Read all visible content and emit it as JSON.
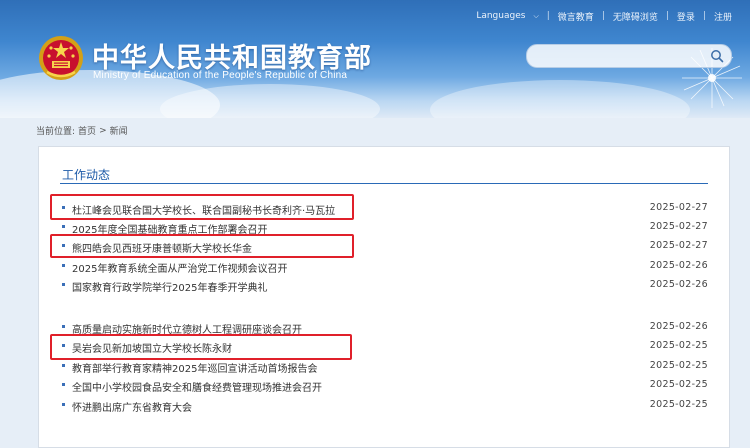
{
  "topnav": {
    "languages": "Languages",
    "wechat": "微言教育",
    "accessibility": "无障碍浏览",
    "login": "登录",
    "register": "注册"
  },
  "header": {
    "title_cn": "中华人民共和国教育部",
    "title_en": "Ministry of Education of the People's Republic of China"
  },
  "search": {
    "placeholder": ""
  },
  "breadcrumb": {
    "label": "当前位置:",
    "home": "首页",
    "sep": ">",
    "current": "新闻"
  },
  "section": {
    "title": "工作动态",
    "items": [
      {
        "text": "杜江峰会见联合国大学校长、联合国副秘书长奇利齐·马瓦拉",
        "date": "2025-02-27",
        "highlighted": true
      },
      {
        "text": "2025年度全国基础教育重点工作部署会召开",
        "date": "2025-02-27",
        "highlighted": false
      },
      {
        "text": "熊四皓会见西班牙康普顿斯大学校长华金",
        "date": "2025-02-27",
        "highlighted": true
      },
      {
        "text": "2025年教育系统全面从严治党工作视频会议召开",
        "date": "2025-02-26",
        "highlighted": false
      },
      {
        "text": "国家教育行政学院举行2025年春季开学典礼",
        "date": "2025-02-26",
        "highlighted": false
      },
      {
        "text": "高质量启动实施新时代立德树人工程调研座谈会召开",
        "date": "2025-02-26",
        "highlighted": false
      },
      {
        "text": "吴岩会见新加坡国立大学校长陈永财",
        "date": "2025-02-25",
        "highlighted": true
      },
      {
        "text": "教育部举行教育家精神2025年巡回宣讲活动首场报告会",
        "date": "2025-02-25",
        "highlighted": false
      },
      {
        "text": "全国中小学校园食品安全和膳食经费管理现场推进会召开",
        "date": "2025-02-25",
        "highlighted": false
      },
      {
        "text": "怀进鹏出席广东省教育大会",
        "date": "2025-02-25",
        "highlighted": false
      }
    ]
  },
  "colors": {
    "highlight": "#e0202a",
    "link": "#333333",
    "section_title": "#1e5ba8"
  }
}
